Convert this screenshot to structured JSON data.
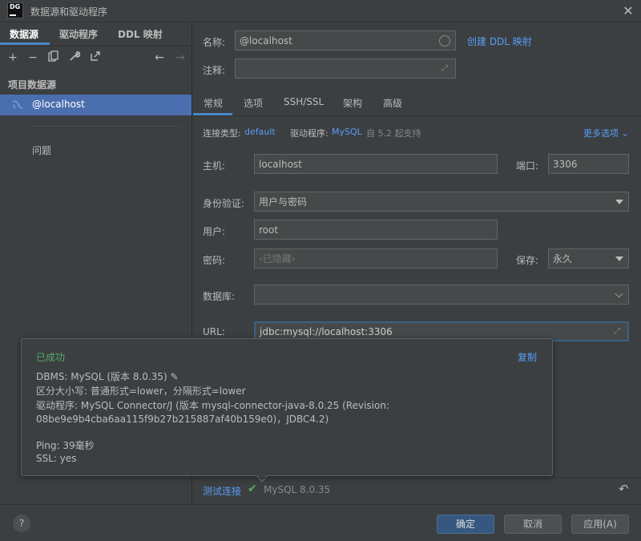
{
  "window": {
    "logo_text": "DG",
    "title": "数据源和驱动程序",
    "close_icon": "close-icon"
  },
  "left": {
    "tabs": [
      {
        "label": "数据源"
      },
      {
        "label": "驱动程序"
      },
      {
        "label": "DDL 映射"
      }
    ],
    "toolbar": [
      "add-icon",
      "remove-icon",
      "duplicate-icon",
      "wrench-icon",
      "jump-icon",
      "back-icon",
      "forward-icon"
    ],
    "section_header": "项目数据源",
    "datasource": "@localhost",
    "problems": "问题"
  },
  "right": {
    "name_label": "名称:",
    "name_value": "@localhost",
    "create_ddl_link": "创建 DDL 映射",
    "comment_label": "注释:",
    "comment_value": "",
    "tabs": [
      {
        "label": "常规"
      },
      {
        "label": "选项"
      },
      {
        "label": "SSH/SSL"
      },
      {
        "label": "架构"
      },
      {
        "label": "高级"
      }
    ],
    "conn_type_label": "连接类型:",
    "conn_type_value": "default",
    "driver_label": "驱动程序:",
    "driver_value": "MySQL",
    "driver_support": "自 5.2 起支持",
    "more_options": "更多选项",
    "host_label": "主机:",
    "host_value": "localhost",
    "port_label": "端口:",
    "port_value": "3306",
    "auth_label": "身份验证:",
    "auth_value": "用户与密码",
    "user_label": "用户:",
    "user_value": "root",
    "password_label": "密码:",
    "password_placeholder": "‹已隐藏›",
    "save_label": "保存:",
    "save_value": "永久",
    "database_label": "数据库:",
    "database_value": "",
    "url_label": "URL:",
    "url_value": "jdbc:mysql://localhost:3306"
  },
  "popup": {
    "status": "已成功",
    "copy": "复制",
    "dbms": "DBMS: MySQL (版本 8.0.35)",
    "case": "区分大小写: 普通形式=lower，分隔形式=lower",
    "driver_line1": "驱动程序: MySQL Connector/J (版本 mysql-connector-java-8.0.25 (Revision:",
    "driver_line2": "08be9e9b4cba6aa115f9b27b215887af40b159e0)，JDBC4.2)",
    "ping": "Ping: 39毫秒",
    "ssl": "SSL: yes"
  },
  "test": {
    "link": "测试连接",
    "result": "MySQL 8.0.35",
    "status_color": "#59a869"
  },
  "footer": {
    "help": "?",
    "ok": "确定",
    "cancel": "取消",
    "apply": "应用(A)"
  },
  "colors": {
    "accent": "#4a88c7",
    "link": "#589df6",
    "success": "#59a869",
    "selection": "#4b6eaf"
  }
}
